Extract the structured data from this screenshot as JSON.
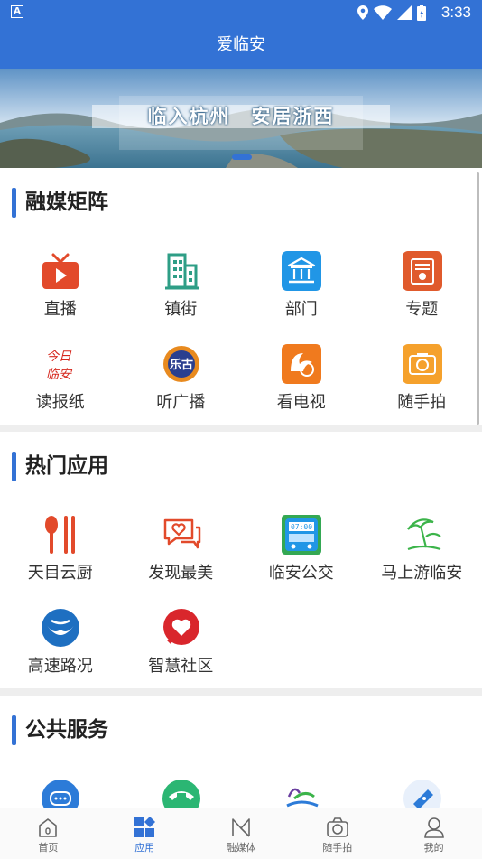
{
  "status_bar": {
    "time": "3:33",
    "notification_glyph": "A"
  },
  "header": {
    "title": "爱临安"
  },
  "banner": {
    "slogan": "临入杭州　安居浙西"
  },
  "sections": [
    {
      "title": "融媒矩阵",
      "items": [
        {
          "label": "直播",
          "icon": "live-tv-icon"
        },
        {
          "label": "镇街",
          "icon": "buildings-icon"
        },
        {
          "label": "部门",
          "icon": "government-building-icon"
        },
        {
          "label": "专题",
          "icon": "topic-icon"
        },
        {
          "label": "读报纸",
          "icon": "newspaper-logo-icon"
        },
        {
          "label": "听广播",
          "icon": "radio-logo-icon"
        },
        {
          "label": "看电视",
          "icon": "tv-logo-icon"
        },
        {
          "label": "随手拍",
          "icon": "camera-icon"
        }
      ]
    },
    {
      "title": "热门应用",
      "items": [
        {
          "label": "天目云厨",
          "icon": "spoon-chopsticks-icon"
        },
        {
          "label": "发现最美",
          "icon": "heart-chat-icon"
        },
        {
          "label": "临安公交",
          "icon": "bus-icon"
        },
        {
          "label": "马上游临安",
          "icon": "beach-umbrella-icon"
        },
        {
          "label": "高速路况",
          "icon": "highway-logo-icon"
        },
        {
          "label": "智慧社区",
          "icon": "community-heart-icon"
        }
      ]
    },
    {
      "title": "公共服务",
      "items": [
        {
          "label": "",
          "icon": "chat-bubble-icon"
        },
        {
          "label": "",
          "icon": "telephone-icon"
        },
        {
          "label": "",
          "icon": "scenery-logo-icon"
        },
        {
          "label": "",
          "icon": "ticket-icon"
        }
      ]
    }
  ],
  "tabs": [
    {
      "label": "首页",
      "icon": "home-icon",
      "active": false
    },
    {
      "label": "应用",
      "icon": "apps-grid-icon",
      "active": true
    },
    {
      "label": "融媒体",
      "icon": "media-icon",
      "active": false
    },
    {
      "label": "随手拍",
      "icon": "camera-icon",
      "active": false
    },
    {
      "label": "我的",
      "icon": "user-icon",
      "active": false
    }
  ],
  "colors": {
    "brand": "#3372d5",
    "accent_red": "#e24a2b",
    "tab_active": "#3372d5"
  }
}
